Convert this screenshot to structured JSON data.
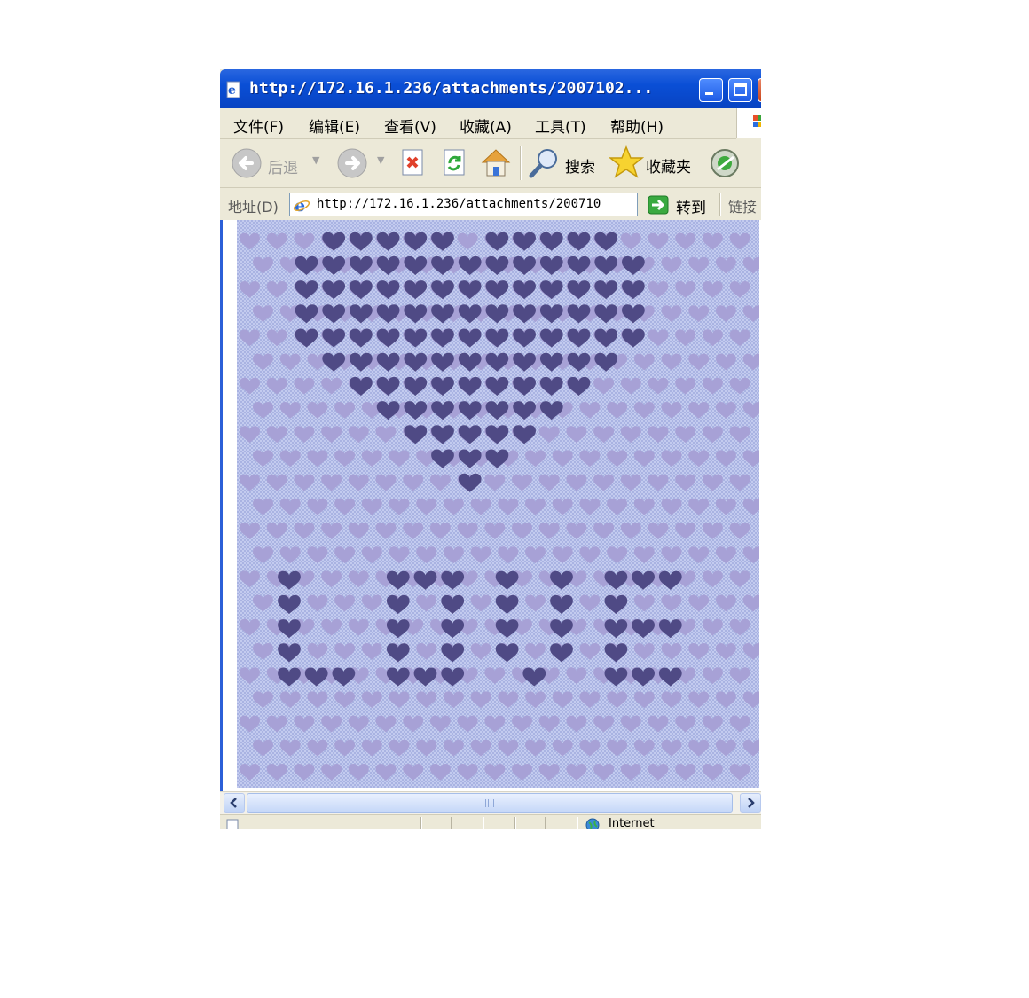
{
  "window": {
    "title": "http://172.16.1.236/attachments/2007102..."
  },
  "menu": {
    "items": [
      "文件(F)",
      "编辑(E)",
      "查看(V)",
      "收藏(A)",
      "工具(T)",
      "帮助(H)"
    ]
  },
  "toolbar": {
    "back_label": "后退",
    "search_label": "搜索",
    "favorites_label": "收藏夹"
  },
  "address_bar": {
    "label": "地址(D)",
    "url": "http://172.16.1.236/attachments/200710",
    "go_label": "转到",
    "links_label": "链接"
  },
  "status_bar": {
    "zone_text": "Internet"
  },
  "colors": {
    "window_blue": "#0a4fd6",
    "pattern_background": "#b5bfe8",
    "faint_heart": "#a7a1d6",
    "dark_heart": "#4f4a85"
  },
  "content_image": {
    "description_icon": "heart-pattern-image",
    "heart_shape_rows": [
      [
        3,
        4,
        5,
        6,
        7,
        9,
        10,
        11,
        12,
        13
      ],
      [
        2,
        3,
        4,
        5,
        6,
        7,
        8,
        9,
        10,
        11,
        12,
        13,
        14
      ],
      [
        2,
        3,
        4,
        5,
        6,
        7,
        8,
        9,
        10,
        11,
        12,
        13,
        14
      ],
      [
        2,
        3,
        4,
        5,
        6,
        7,
        8,
        9,
        10,
        11,
        12,
        13,
        14
      ],
      [
        2,
        3,
        4,
        5,
        6,
        7,
        8,
        9,
        10,
        11,
        12,
        13,
        14
      ],
      [
        3,
        4,
        5,
        6,
        7,
        8,
        9,
        10,
        11,
        12,
        13
      ],
      [
        4,
        5,
        6,
        7,
        8,
        9,
        10,
        11,
        12
      ],
      [
        5,
        6,
        7,
        8,
        9,
        10,
        11
      ],
      [
        6,
        7,
        8,
        9,
        10
      ],
      [
        7,
        8,
        9
      ],
      [
        8
      ]
    ],
    "word_rows": [
      [
        1,
        5,
        6,
        7,
        9,
        11,
        13,
        14,
        15
      ],
      [
        1,
        5,
        7,
        9,
        11,
        13
      ],
      [
        1,
        5,
        7,
        9,
        11,
        13,
        14,
        15
      ],
      [
        1,
        5,
        7,
        9,
        11,
        13
      ],
      [
        1,
        2,
        3,
        5,
        6,
        7,
        10,
        13,
        14,
        15
      ]
    ]
  }
}
